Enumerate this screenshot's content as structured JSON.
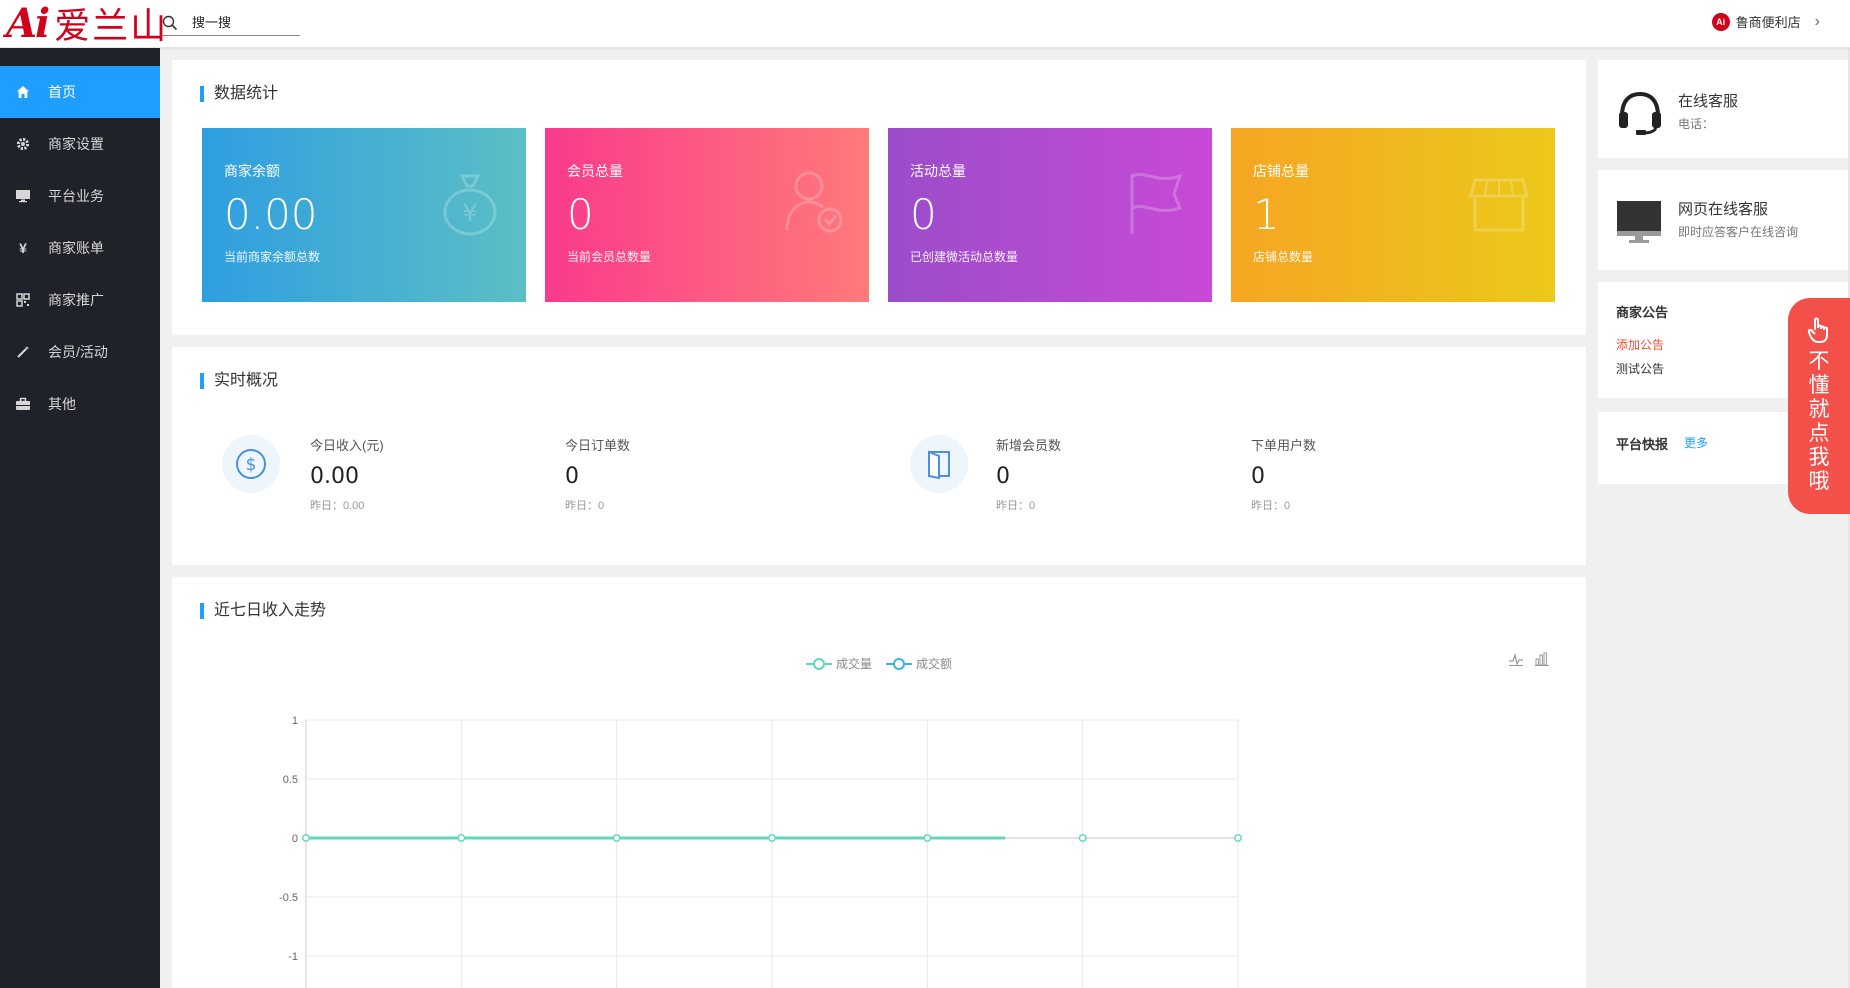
{
  "header": {
    "logo_ai": "Ai",
    "logo_text": "爱兰山",
    "search_placeholder": "搜一搜",
    "shop_name": "鲁商便利店",
    "shop_badge": "Ai"
  },
  "sidebar": {
    "items": [
      {
        "label": "首页",
        "icon": "home-icon",
        "active": true
      },
      {
        "label": "商家设置",
        "icon": "gear-icon",
        "active": false
      },
      {
        "label": "平台业务",
        "icon": "monitor-icon",
        "active": false
      },
      {
        "label": "商家账单",
        "icon": "yen-icon",
        "active": false
      },
      {
        "label": "商家推广",
        "icon": "qrcode-icon",
        "active": false
      },
      {
        "label": "会员/活动",
        "icon": "magic-wand-icon",
        "active": false
      },
      {
        "label": "其他",
        "icon": "briefcase-icon",
        "active": false
      }
    ]
  },
  "stats": {
    "title": "数据统计",
    "cards": [
      {
        "label": "商家余额",
        "value": "0.00",
        "desc": "当前商家余额总数",
        "icon": "money-bag-icon"
      },
      {
        "label": "会员总量",
        "value": "0",
        "desc": "当前会员总数量",
        "icon": "user-check-icon"
      },
      {
        "label": "活动总量",
        "value": "0",
        "desc": "已创建微活动总数量",
        "icon": "flag-icon"
      },
      {
        "label": "店铺总量",
        "value": "1",
        "desc": "店铺总数量",
        "icon": "store-icon"
      }
    ]
  },
  "realtime": {
    "title": "实时概况",
    "items": [
      {
        "label": "今日收入(元)",
        "value": "0.00",
        "sub": "昨日：0.00"
      },
      {
        "label": "今日订单数",
        "value": "0",
        "sub": "昨日：0"
      },
      {
        "label": "新增会员数",
        "value": "0",
        "sub": "昨日：0"
      },
      {
        "label": "下单用户数",
        "value": "0",
        "sub": "昨日：0"
      }
    ]
  },
  "trend": {
    "title": "近七日收入走势",
    "legend": [
      "成交量",
      "成交额"
    ],
    "colors": {
      "series_a": "#5ed8c3",
      "series_b": "#3ab6d9"
    }
  },
  "chart_data": {
    "type": "line",
    "title": "",
    "xlabel": "",
    "ylabel": "",
    "categories": [
      "",
      "",
      "",
      "",
      "",
      "",
      ""
    ],
    "y_ticks": [
      "1",
      "0.5",
      "0",
      "-0.5",
      "-1"
    ],
    "ylim": [
      -1,
      1
    ],
    "grid": true,
    "legend_position": "top-center",
    "series": [
      {
        "name": "成交量",
        "values": [
          0,
          0,
          0,
          0,
          0,
          0,
          0
        ]
      },
      {
        "name": "成交额",
        "values": [
          0,
          0,
          0,
          0,
          0,
          0,
          0
        ]
      }
    ]
  },
  "right": {
    "service": {
      "title": "在线客服",
      "sub": "电话："
    },
    "web_service": {
      "title": "网页在线客服",
      "sub": "即时应答客户在线咨询"
    },
    "notice": {
      "title": "商家公告",
      "add": "添加公告",
      "item": "测试公告"
    },
    "news": {
      "title": "平台快报",
      "more": "更多"
    },
    "help": "不懂就点我哦"
  }
}
